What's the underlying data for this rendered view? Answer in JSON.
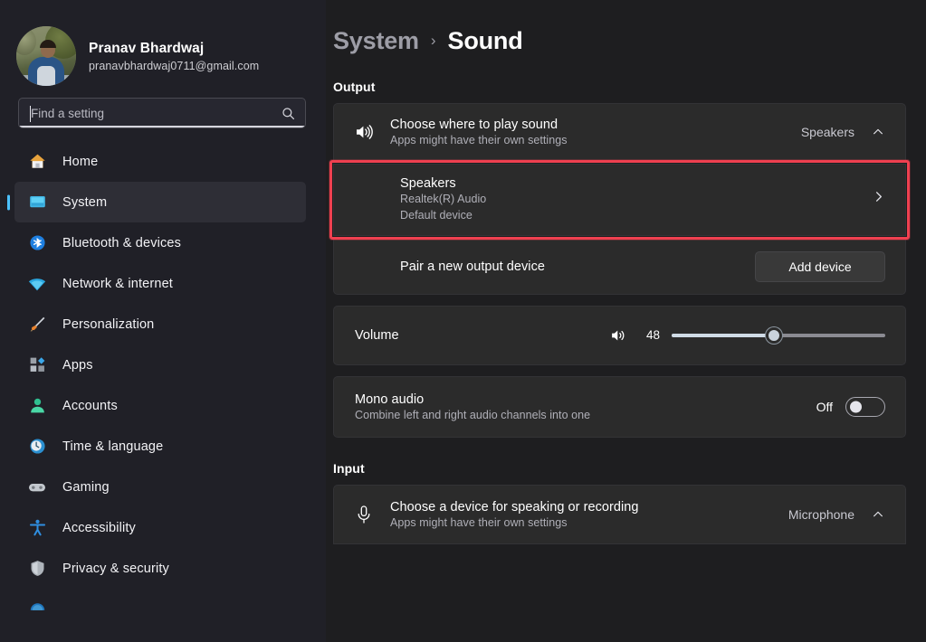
{
  "window": {
    "app_name": "Settings",
    "theme": "dark",
    "accent_color": "#4cc2ff",
    "highlight_color": "#ef4050"
  },
  "sidebar": {
    "profile": {
      "name": "Pranav Bhardwaj",
      "email": "pranavbhardwaj0711@gmail.com",
      "avatar_icon": "user-photo"
    },
    "search": {
      "placeholder": "Find a setting",
      "value": "",
      "icon": "search-icon",
      "focused": true
    },
    "items": [
      {
        "label": "Home",
        "icon": "home-icon",
        "selected": false
      },
      {
        "label": "System",
        "icon": "system-display-icon",
        "selected": true
      },
      {
        "label": "Bluetooth & devices",
        "icon": "bluetooth-icon",
        "selected": false
      },
      {
        "label": "Network & internet",
        "icon": "wifi-icon",
        "selected": false
      },
      {
        "label": "Personalization",
        "icon": "paintbrush-icon",
        "selected": false
      },
      {
        "label": "Apps",
        "icon": "apps-icon",
        "selected": false
      },
      {
        "label": "Accounts",
        "icon": "account-icon",
        "selected": false
      },
      {
        "label": "Time & language",
        "icon": "clock-icon",
        "selected": false
      },
      {
        "label": "Gaming",
        "icon": "gamepad-icon",
        "selected": false
      },
      {
        "label": "Accessibility",
        "icon": "accessibility-icon",
        "selected": false
      },
      {
        "label": "Privacy & security",
        "icon": "shield-icon",
        "selected": false
      },
      {
        "label": "",
        "icon": "windows-update-icon",
        "selected": false
      }
    ]
  },
  "header": {
    "breadcrumb_parent": "System",
    "breadcrumb_separator": "›",
    "breadcrumb_current": "Sound"
  },
  "main": {
    "output": {
      "section_title": "Output",
      "choose_device": {
        "icon": "speaker-icon",
        "title": "Choose where to play sound",
        "subtitle": "Apps might have their own settings",
        "value": "Speakers",
        "chevron": "chevron-up-icon"
      },
      "speakers": {
        "title": "Speakers",
        "subtitle": "Realtek(R) Audio",
        "status": "Default device",
        "chevron": "chevron-right-icon",
        "highlighted": true
      },
      "pair": {
        "label": "Pair a new output device",
        "button_label": "Add device"
      },
      "volume": {
        "label": "Volume",
        "icon": "speaker-icon",
        "value": 48,
        "min": 0,
        "max": 100
      },
      "mono": {
        "title": "Mono audio",
        "subtitle": "Combine left and right audio channels into one",
        "state_label": "Off",
        "enabled": false
      }
    },
    "input": {
      "section_title": "Input",
      "choose_device": {
        "icon": "microphone-icon",
        "title": "Choose a device for speaking or recording",
        "subtitle": "Apps might have their own settings",
        "value": "Microphone",
        "chevron": "chevron-up-icon"
      }
    }
  }
}
